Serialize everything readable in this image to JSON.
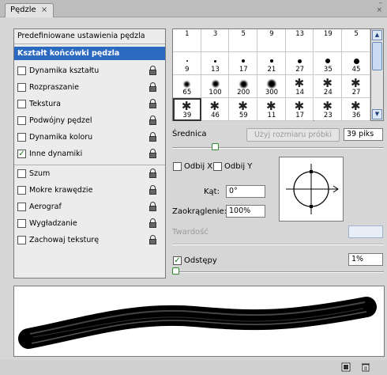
{
  "window": {
    "tab_label": "Pędzle",
    "tab_close": "×",
    "controls": "– ×"
  },
  "left_panel": {
    "preset_header": "Predefiniowane ustawienia pędzla",
    "selected_header": "Kształt końcówki pędzla",
    "items": [
      {
        "label": "Dynamika kształtu",
        "checked": false,
        "locked": true
      },
      {
        "label": "Rozpraszanie",
        "checked": false,
        "locked": true
      },
      {
        "label": "Tekstura",
        "checked": false,
        "locked": true
      },
      {
        "label": "Podwójny pędzel",
        "checked": false,
        "locked": true
      },
      {
        "label": "Dynamika koloru",
        "checked": false,
        "locked": true
      },
      {
        "label": "Inne dynamiki",
        "checked": true,
        "locked": true
      },
      {
        "label": "Szum",
        "checked": false,
        "locked": true
      },
      {
        "label": "Mokre krawędzie",
        "checked": false,
        "locked": true
      },
      {
        "label": "Aerograf",
        "checked": false,
        "locked": true
      },
      {
        "label": "Wygładzanie",
        "checked": false,
        "locked": true
      },
      {
        "label": "Zachowaj teksturę",
        "checked": false,
        "locked": true
      }
    ]
  },
  "brush_grid": {
    "rows": [
      [
        "1",
        "3",
        "5",
        "9",
        "13",
        "19",
        "5"
      ],
      [
        "9",
        "13",
        "17",
        "21",
        "27",
        "35",
        "45"
      ],
      [
        "65",
        "100",
        "200",
        "300",
        "14",
        "24",
        "27"
      ],
      [
        "39",
        "46",
        "59",
        "11",
        "17",
        "23",
        "36"
      ]
    ],
    "selected": "39"
  },
  "controls": {
    "diameter_label": "Średnica",
    "sample_button": "Użyj rozmiaru próbki",
    "diameter_value": "39 piks",
    "diameter_slider": 0.2,
    "flip_x_label": "Odbij X",
    "flip_y_label": "Odbij Y",
    "angle_label": "Kąt:",
    "angle_value": "0°",
    "roundness_label": "Zaokrąglenie:",
    "roundness_value": "100%",
    "hardness_label": "Twardość",
    "hardness_value": "",
    "spacing_label": "Odstępy",
    "spacing_checked": true,
    "spacing_value": "1%",
    "spacing_slider": 0.0
  },
  "colors": {
    "selection": "#2c6ac2",
    "slider_thumb": "#2f8a2f"
  }
}
